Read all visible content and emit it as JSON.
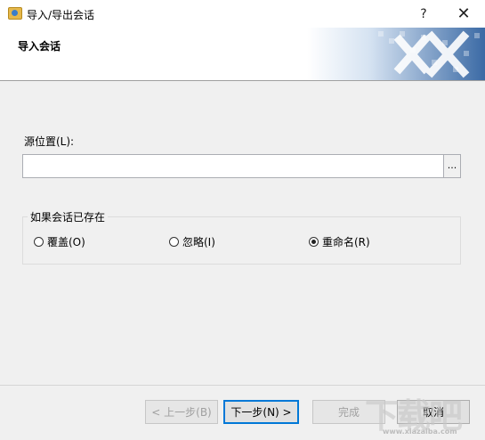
{
  "window": {
    "title": "导入/导出会话",
    "help_label": "?",
    "close_label": "✕",
    "icon": "folder-icon"
  },
  "header": {
    "title": "导入会话",
    "art": "xshell-logo-art"
  },
  "source": {
    "label": "源位置(L):",
    "value": "",
    "browse_label": "..."
  },
  "conflict_group": {
    "legend": "如果会话已存在",
    "options": [
      {
        "label": "覆盖(O)",
        "checked": false
      },
      {
        "label": "忽略(I)",
        "checked": false
      },
      {
        "label": "重命名(R)",
        "checked": true
      }
    ]
  },
  "footer": {
    "back_label": "< 上一步(B)",
    "next_label": "下一步(N) >",
    "finish_label": "完成",
    "cancel_label": "取消"
  },
  "watermark": {
    "text": "下载吧",
    "url": "www.xiazaiba.com"
  },
  "colors": {
    "accent": "#0078d7",
    "background": "#f0f0f0",
    "header_art": "#3b6aa5"
  }
}
